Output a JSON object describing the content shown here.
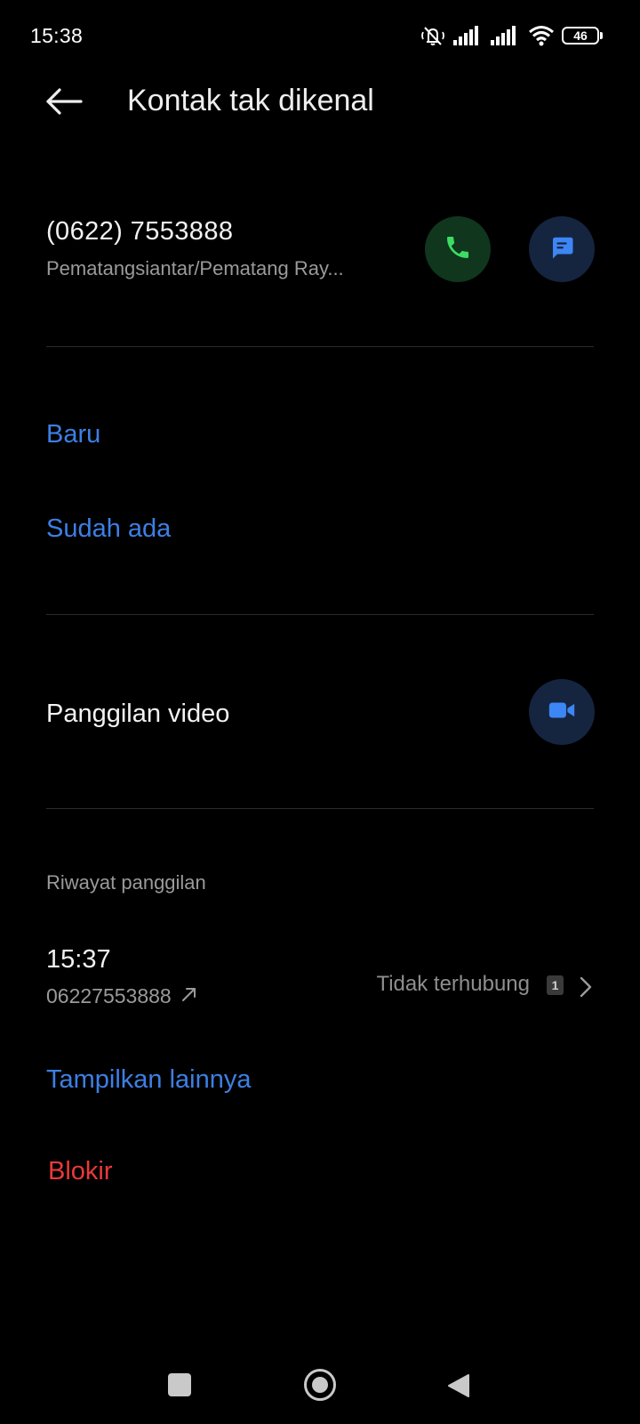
{
  "status_bar": {
    "time": "15:38",
    "battery": "46",
    "icons": [
      "mute-vibrate-icon",
      "signal-icon",
      "signal-icon",
      "wifi-icon",
      "battery-icon"
    ]
  },
  "app_bar": {
    "title": "Kontak tak dikenal",
    "back_icon": "arrow-left-icon"
  },
  "contact": {
    "number": "(0622) 7553888",
    "location": "Pematangsiantar/Pematang Ray...",
    "call_icon": "phone-icon",
    "message_icon": "message-icon"
  },
  "add_contact": {
    "new_label": "Baru",
    "existing_label": "Sudah ada"
  },
  "video_call": {
    "label": "Panggilan video",
    "icon": "video-camera-icon"
  },
  "call_history": {
    "heading": "Riwayat panggilan",
    "entries": [
      {
        "time": "15:37",
        "number": "06227553888",
        "direction_icon": "outgoing-arrow-icon",
        "status": "Tidak terhubung",
        "count": "1"
      }
    ],
    "show_more_label": "Tampilkan lainnya"
  },
  "block_label": "Blokir",
  "colors": {
    "background": "#000000",
    "link": "#3d7fe4",
    "danger": "#e9393c",
    "call_button_bg": "#10361e",
    "call_icon": "#3ddc62",
    "action_button_bg": "#152540",
    "action_icon": "#3d86f5"
  },
  "nav_bar": {
    "icons": [
      "recents-square-icon",
      "home-circle-icon",
      "back-triangle-icon"
    ]
  }
}
